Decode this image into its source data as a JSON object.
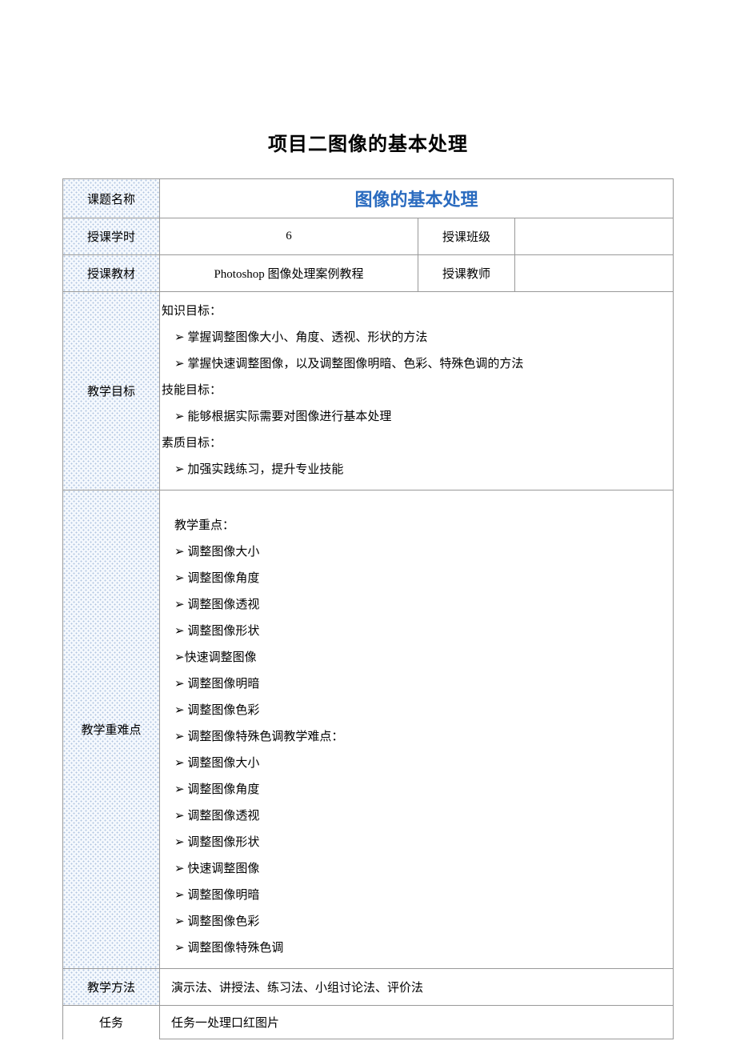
{
  "pageTitle": "项目二图像的基本处理",
  "labels": {
    "topicName": "课题名称",
    "hours": "授课学时",
    "class": "授课班级",
    "textbook": "授课教材",
    "teacher": "授课教师",
    "objectives": "教学目标",
    "keyDifficult": "教学重难点",
    "method": "教学方法",
    "task": "任务"
  },
  "topic": "图像的基本处理",
  "hoursValue": "6",
  "classValue": "",
  "textbookValue": "Photoshop 图像处理案例教程",
  "teacherValue": "",
  "objectives": {
    "h1": "知识目标：",
    "k1": "➢ 掌握调整图像大小、角度、透视、形状的方法",
    "k2": "➢ 掌握快速调整图像，以及调整图像明暗、色彩、特殊色调的方法",
    "h2": "技能目标：",
    "s1": "➢ 能够根据实际需要对图像进行基本处理",
    "h3": "素质目标：",
    "q1": "➢ 加强实践练习，提升专业技能"
  },
  "keyDifficult": {
    "h1": "教学重点：",
    "k1": "➢ 调整图像大小",
    "k2": "➢ 调整图像角度",
    "k3": "➢ 调整图像透视",
    "k4": "➢ 调整图像形状",
    "k5": "➢快速调整图像",
    "k6": "➢ 调整图像明暗",
    "k7": "➢ 调整图像色彩",
    "k8": "➢ 调整图像特殊色调教学难点：",
    "d1": "➢ 调整图像大小",
    "d2": "➢ 调整图像角度",
    "d3": "➢ 调整图像透视",
    "d4": "➢ 调整图像形状",
    "d5": "➢ 快速调整图像",
    "d6": "➢ 调整图像明暗",
    "d7": "➢ 调整图像色彩",
    "d8": "➢ 调整图像特殊色调"
  },
  "methodValue": "演示法、讲授法、练习法、小组讨论法、评价法",
  "taskValue": "任务一处理口红图片"
}
